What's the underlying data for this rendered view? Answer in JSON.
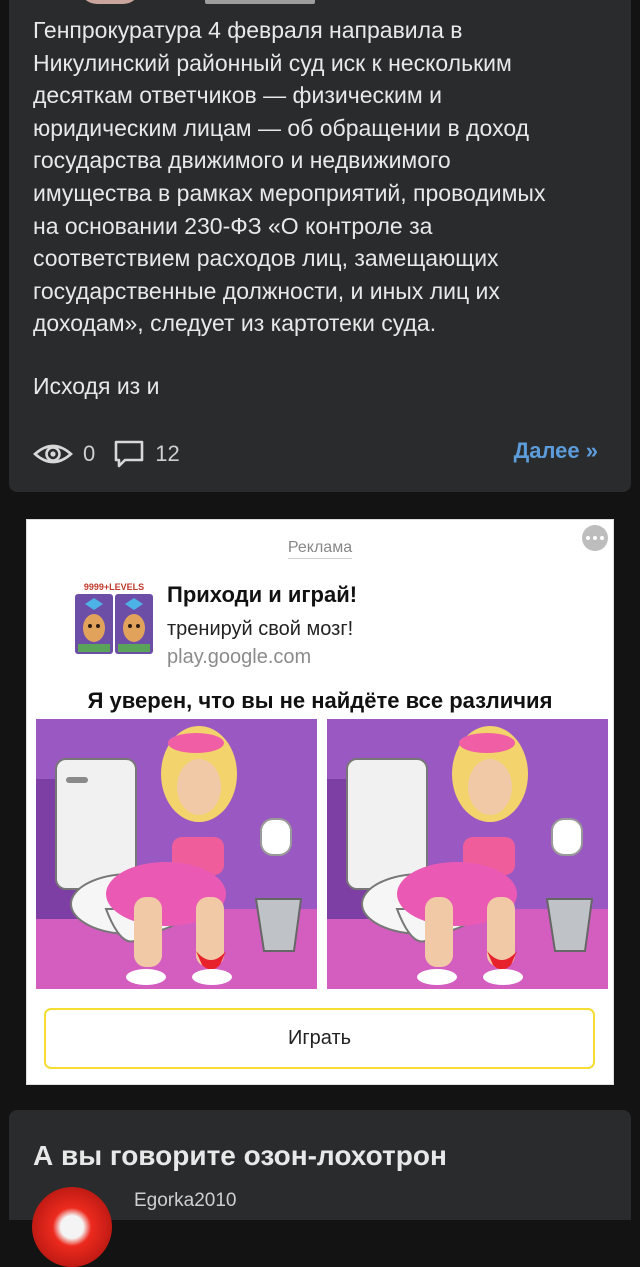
{
  "article": {
    "body": "Генпрокуратура 4 февраля направила в\nНикулинский районный суд иск к нескольким\nдесяткам ответчиков — физическим и\nюридическим лицам — об обращении в доход\nгосударства движимого и недвижимого\nимущества в рамках мероприятий, проводимых\nна основании 230-ФЗ «О контроле за\nсоответствием расходов лиц, замещающих\nгосударственные должности, и иных лиц их\nдоходам», следует из картотеки суда.",
    "snippet": "Исходя из и",
    "views": "0",
    "comments": "12",
    "more_label": "Далее »"
  },
  "ad": {
    "label": "Реклама",
    "app_badge": "9999+LEVELS",
    "title": "Приходи и играй!",
    "subtitle": "тренируй свой мозг!",
    "domain": "play.google.com",
    "headline": "Я уверен, что вы не найдёте все различия",
    "cta": "Играть",
    "colors": {
      "cta_border": "#f5dd33",
      "bg_purple": "#9a59c2",
      "skirt_pink": "#e85fae"
    }
  },
  "next_post": {
    "title": "А вы говорите озон-лохотрон",
    "author": "Egorka2010"
  },
  "theme": {
    "background": "#131313",
    "card": "#2a2b2d",
    "link": "#5d9cdb"
  },
  "icons": [
    "eye-icon",
    "comment-icon",
    "more-dots-icon"
  ]
}
